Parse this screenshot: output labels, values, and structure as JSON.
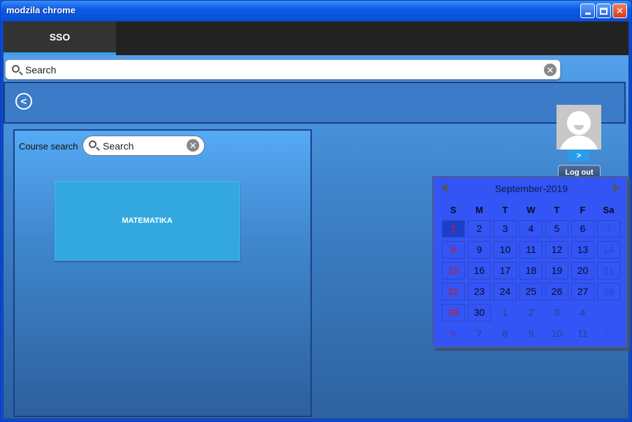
{
  "window": {
    "title": "modzila chrome"
  },
  "nav": {
    "tab_label": "SSO"
  },
  "search": {
    "placeholder": "Search",
    "clear_glyph": "✕"
  },
  "toolbar": {
    "back_glyph": "<"
  },
  "course_panel": {
    "label": "Course search",
    "search_placeholder": "Search",
    "courses": [
      "MATEMATIKA"
    ]
  },
  "user": {
    "next_label": ">",
    "logout_label": "Log out"
  },
  "calendar": {
    "month_label": "September-2019",
    "weekdays": [
      "S",
      "M",
      "T",
      "W",
      "T",
      "F",
      "Sa"
    ],
    "weeks": [
      [
        "1",
        "2",
        "3",
        "4",
        "5",
        "6",
        "7"
      ],
      [
        "8",
        "9",
        "10",
        "11",
        "12",
        "13",
        "14"
      ],
      [
        "15",
        "16",
        "17",
        "18",
        "19",
        "20",
        "21"
      ],
      [
        "22",
        "23",
        "24",
        "25",
        "26",
        "27",
        "28"
      ],
      [
        "29",
        "30",
        "1",
        "2",
        "3",
        "4",
        "5"
      ],
      [
        "6",
        "7",
        "8",
        "9",
        "10",
        "11",
        "12"
      ]
    ],
    "other_month_from": [
      4,
      2
    ],
    "selected_day": "1"
  },
  "colors": {
    "accent": "#3aa0e8",
    "calendar_bg": "#3355f5",
    "sunday": "#d01818"
  }
}
